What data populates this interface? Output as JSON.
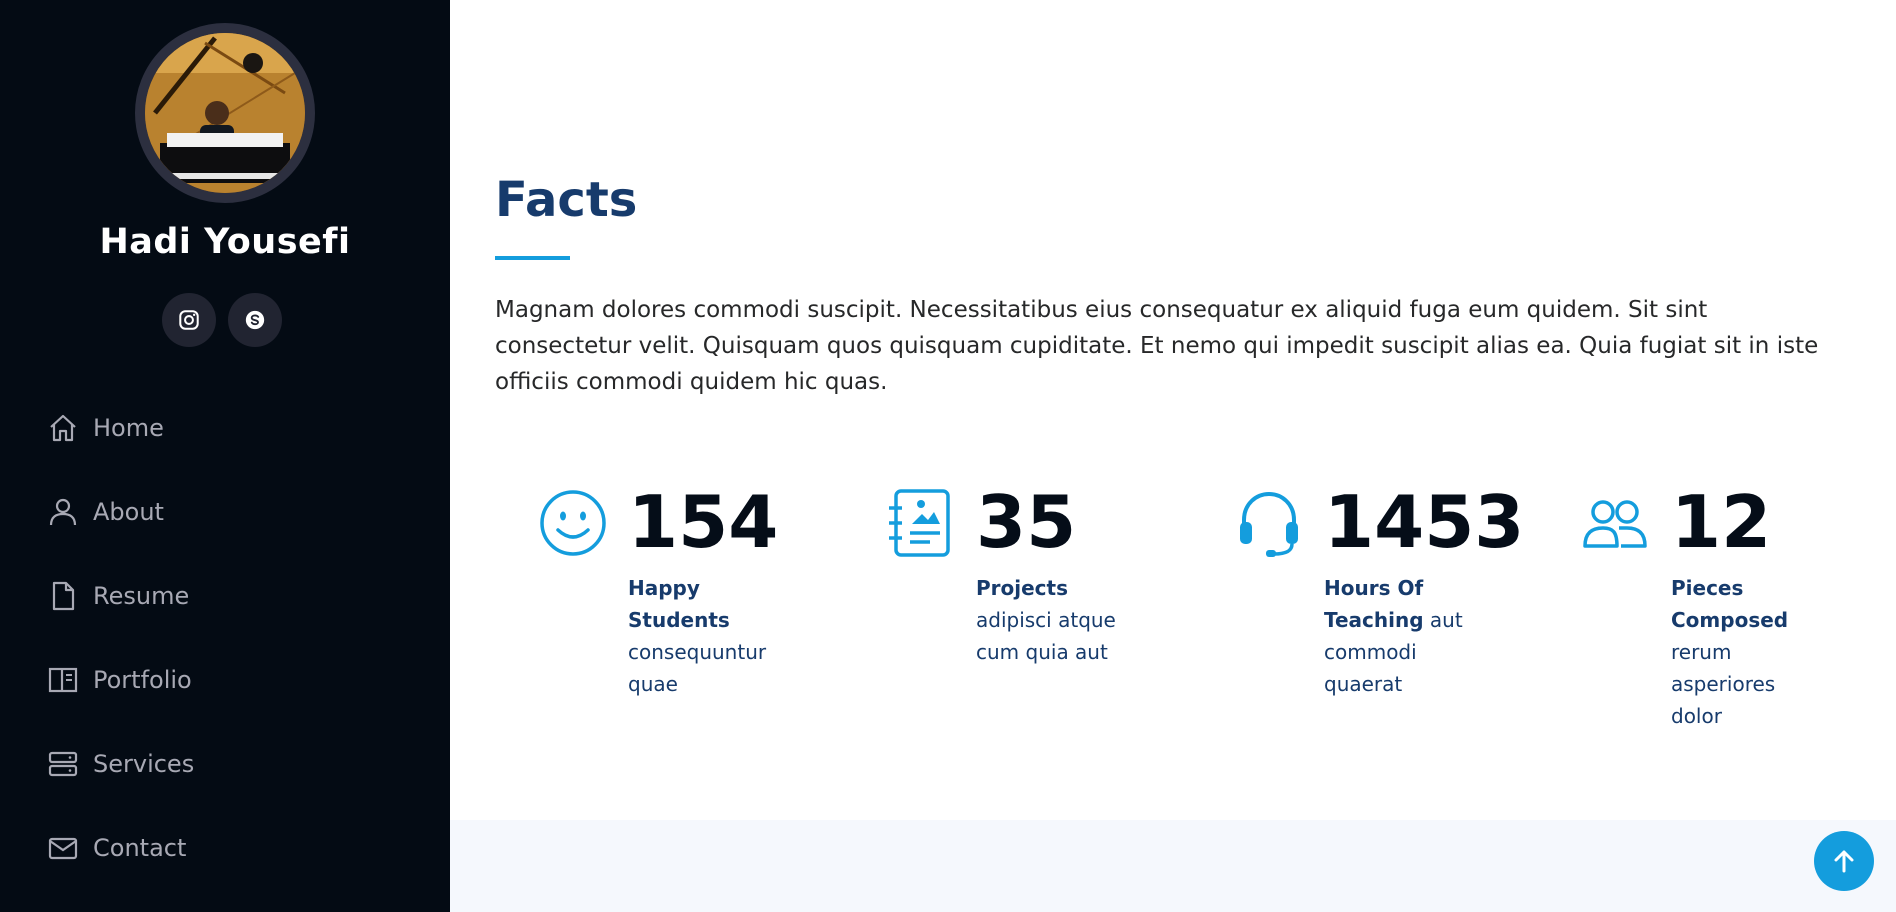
{
  "profile": {
    "name": "Hadi Yousefi",
    "photo": "musician-at-piano-photo"
  },
  "social": [
    {
      "name": "instagram",
      "icon": "instagram-icon"
    },
    {
      "name": "skype",
      "icon": "skype-icon"
    }
  ],
  "nav": {
    "items": [
      {
        "label": "Home",
        "icon": "home-icon"
      },
      {
        "label": "About",
        "icon": "person-icon"
      },
      {
        "label": "Resume",
        "icon": "file-icon"
      },
      {
        "label": "Portfolio",
        "icon": "book-half-icon"
      },
      {
        "label": "Services",
        "icon": "server-icon"
      },
      {
        "label": "Contact",
        "icon": "envelope-icon"
      }
    ]
  },
  "facts": {
    "title": "Facts",
    "description": "Magnam dolores commodi suscipit. Necessitatibus eius consequatur ex aliquid fuga eum quidem. Sit sint consectetur velit. Quisquam quos quisquam cupiditate. Et nemo qui impedit suscipit alias ea. Quia fugiat sit in iste officiis commodi quidem hic quas.",
    "items": [
      {
        "number": "154",
        "label": "Happy Students",
        "text": "consequuntur quae",
        "icon": "emoji-smile-icon"
      },
      {
        "number": "35",
        "label": "Projects",
        "text": "adipisci atque cum quia aut",
        "icon": "journal-richtext-icon"
      },
      {
        "number": "1453",
        "label": "Hours Of Teaching",
        "text": "aut commodi quaerat",
        "icon": "headset-icon"
      },
      {
        "number": "12",
        "label": "Pieces Composed",
        "text": "rerum asperiores dolor",
        "icon": "people-icon"
      }
    ]
  },
  "back_to_top": {
    "icon": "arrow-up-icon"
  },
  "colors": {
    "sidebar_bg": "#040b14",
    "accent": "#149ddd",
    "heading": "#173b6c",
    "nav_text": "#a8a9b4",
    "social_bg": "#212431",
    "section_alt_bg": "#f5f8fd"
  }
}
